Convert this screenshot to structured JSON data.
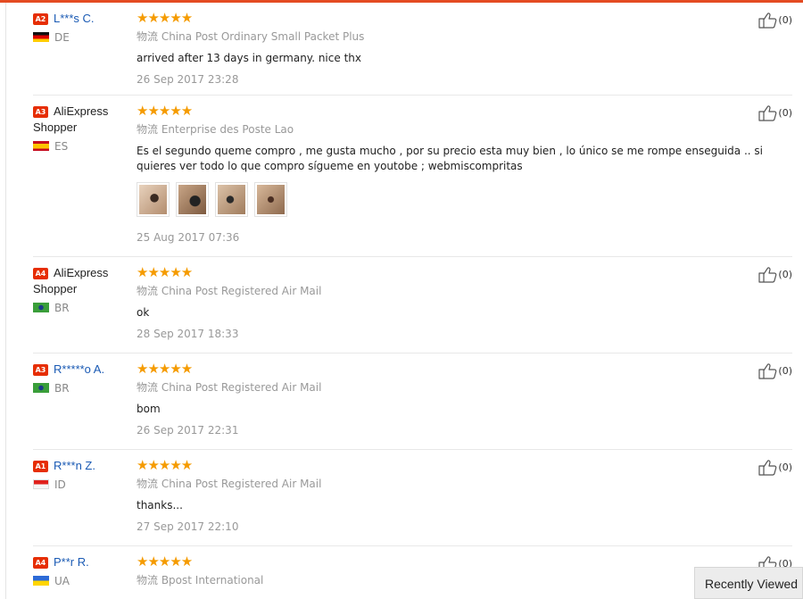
{
  "reviews": [
    {
      "level": "A2",
      "name": "L***s C.",
      "name_style": "blue",
      "country": "DE",
      "flag": "de",
      "stars": "★★★★★",
      "logistics": "物流 China Post Ordinary Small Packet Plus",
      "text": "arrived after 13 days in germany. nice thx",
      "date": "26 Sep 2017 23:28",
      "helpful": "(0)",
      "photos": 0
    },
    {
      "level": "A3",
      "name": "AliExpress Shopper",
      "name_style": "dark",
      "country": "ES",
      "flag": "es",
      "stars": "★★★★★",
      "logistics": "物流 Enterprise des Poste Lao",
      "text": "Es el segundo queme compro , me gusta mucho , por su precio esta muy bien , lo único se me rompe enseguida .. si quieres ver todo lo que compro sígueme en youtobe ; webmiscompritas",
      "date": "25 Aug 2017 07:36",
      "helpful": "(0)",
      "photos": 4
    },
    {
      "level": "A4",
      "name": "AliExpress Shopper",
      "name_style": "dark",
      "country": "BR",
      "flag": "br",
      "stars": "★★★★★",
      "logistics": "物流 China Post Registered Air Mail",
      "text": "ok",
      "date": "28 Sep 2017 18:33",
      "helpful": "(0)",
      "photos": 0
    },
    {
      "level": "A3",
      "name": "R*****o A.",
      "name_style": "blue",
      "country": "BR",
      "flag": "br",
      "stars": "★★★★★",
      "logistics": "物流 China Post Registered Air Mail",
      "text": "bom",
      "date": "26 Sep 2017 22:31",
      "helpful": "(0)",
      "photos": 0
    },
    {
      "level": "A1",
      "name": "R***n Z.",
      "name_style": "blue",
      "country": "ID",
      "flag": "id",
      "stars": "★★★★★",
      "logistics": "物流 China Post Registered Air Mail",
      "text": "thanks...",
      "date": "27 Sep 2017 22:10",
      "helpful": "(0)",
      "photos": 0
    },
    {
      "level": "A4",
      "name": "P**r R.",
      "name_style": "blue",
      "country": "UA",
      "flag": "ua",
      "stars": "★★★★★",
      "logistics": "物流 Bpost International",
      "text": "",
      "date": "",
      "helpful": "(0)",
      "photos": 0
    }
  ],
  "recently_viewed": "Recently Viewed",
  "colors": {
    "accent": "#e44b22",
    "level_badge": "#e62e04",
    "stars": "#f59b00",
    "link": "#1a5ab4"
  },
  "icons": {
    "helpful": "thumbs-up-icon"
  }
}
